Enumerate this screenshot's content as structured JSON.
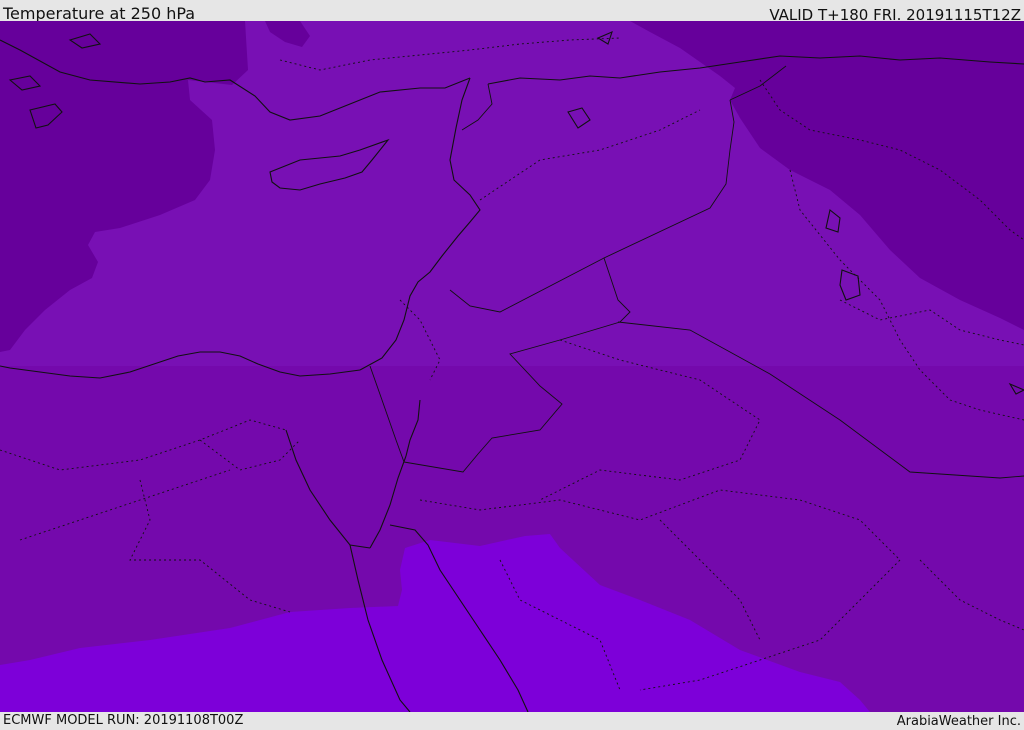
{
  "header": {
    "title": "Temperature at 250 hPa",
    "valid": "VALID T+180 FRI. 20191115T12Z"
  },
  "footer": {
    "model_run": "ECMWF MODEL RUN: 20191108T00Z",
    "brand": "ArabiaWeather Inc."
  },
  "map": {
    "field": "temperature",
    "level": "250 hPa",
    "region": "Eastern Mediterranean, Middle East and Northeast Africa",
    "colors": {
      "cold_band": "#66009b",
      "mid_band": "#7810b4",
      "lower_band": "#7409ac",
      "warm_band": "#7d00d9",
      "coastline": "#111111",
      "borders": "#111111"
    }
  }
}
